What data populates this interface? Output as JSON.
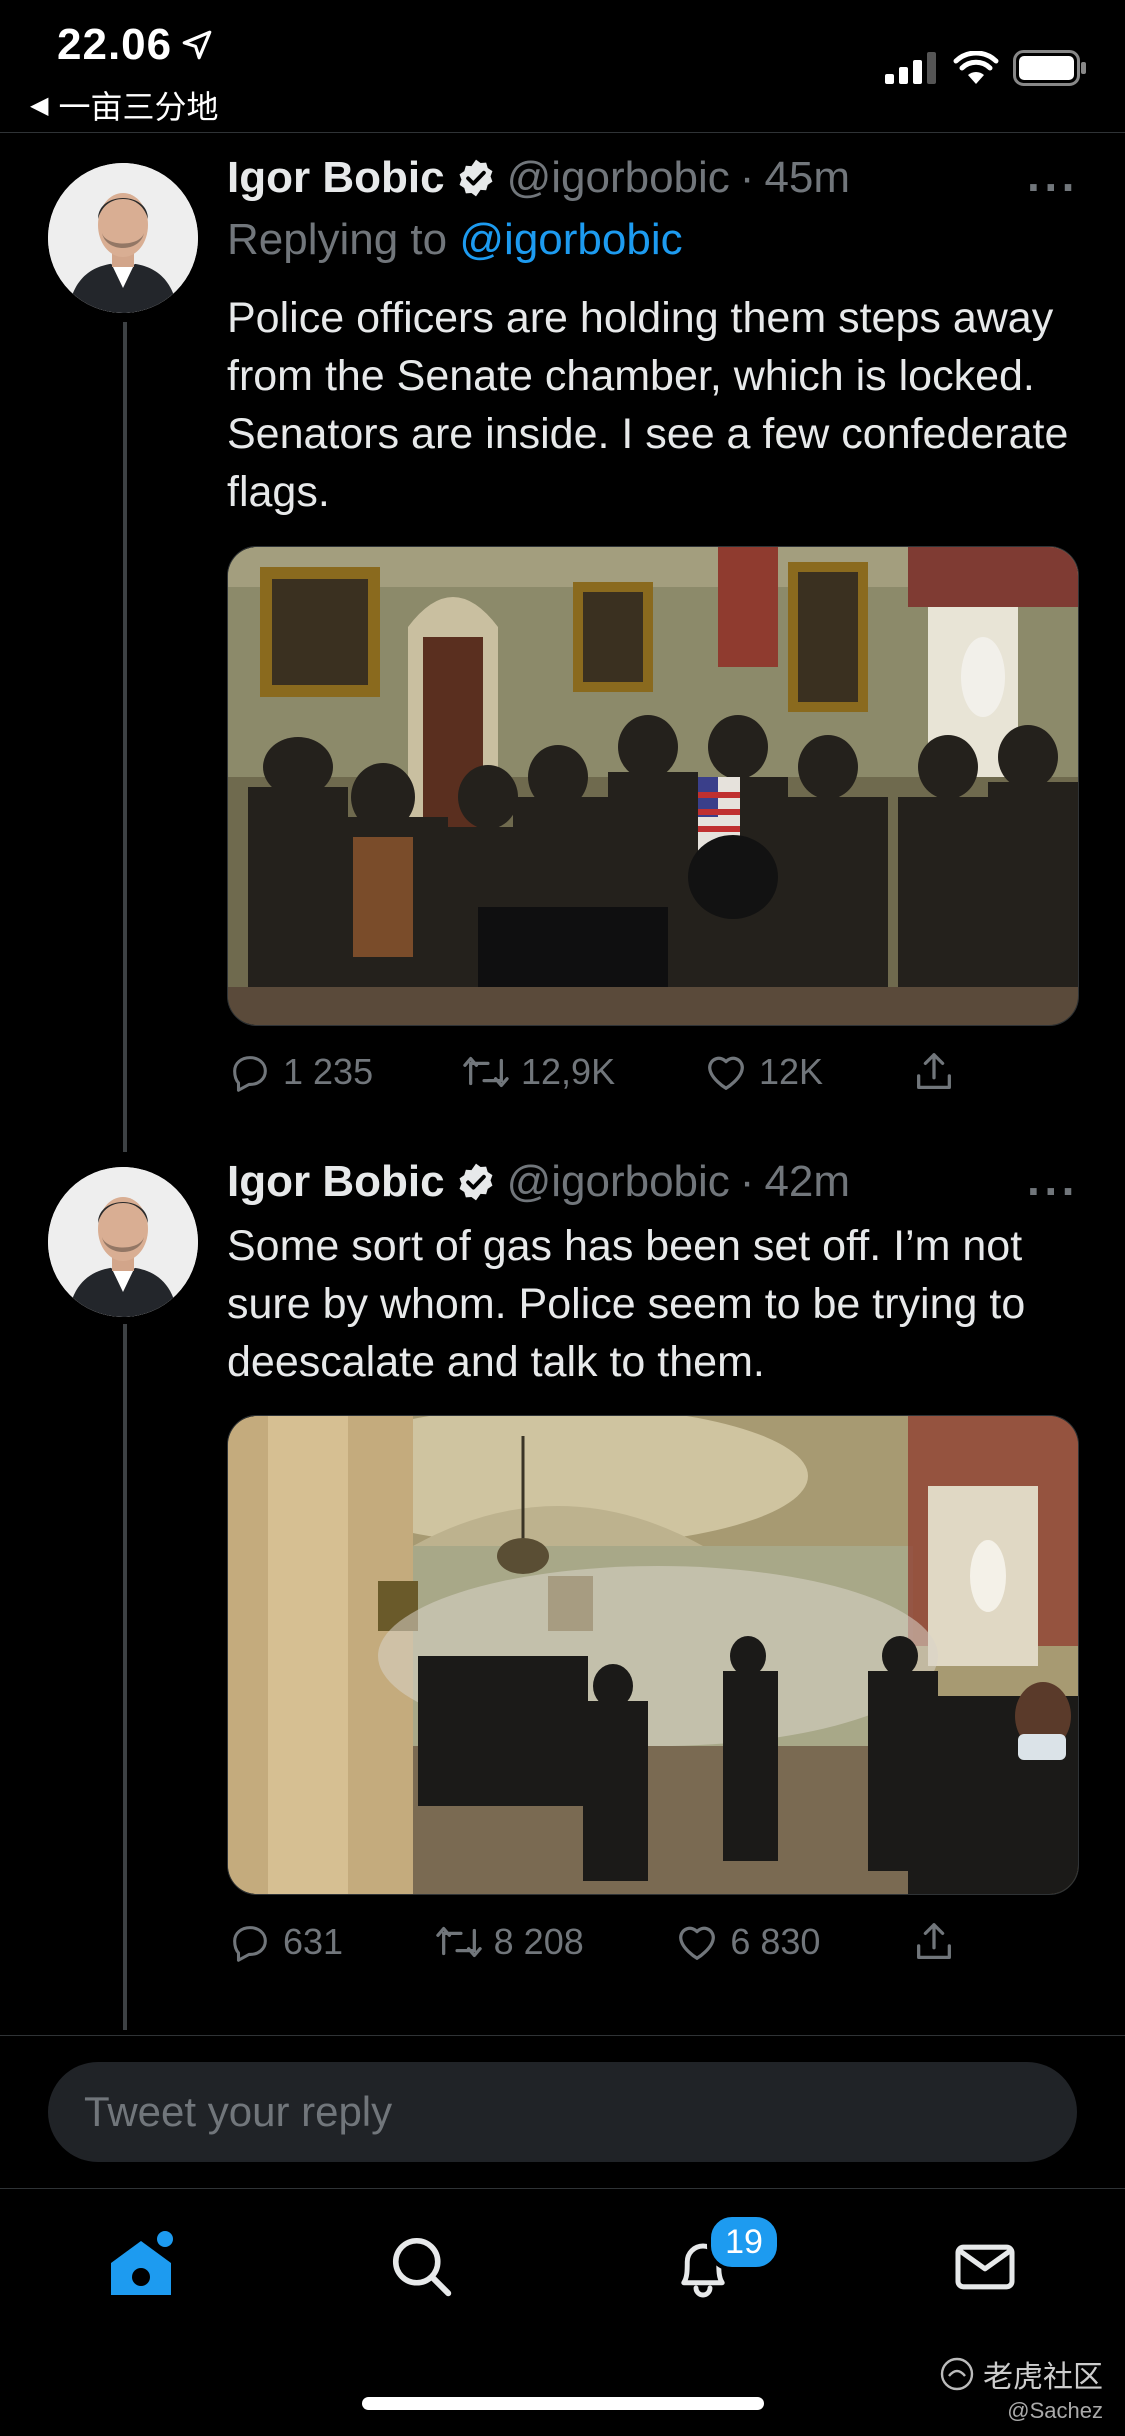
{
  "status_bar": {
    "time": "22.06",
    "back_label": "一亩三分地"
  },
  "tweets": [
    {
      "name": "Igor Bobic",
      "handle": "@igorbobic",
      "dot": "·",
      "time": "45m",
      "replying_prefix": "Replying to",
      "replying_to": "@igorbobic",
      "text": "Police officers are holding them steps away from the Senate chamber, which is locked. Senators are inside. I see a few confederate flags.",
      "replies": "1 235",
      "retweets": "12,9K",
      "likes": "12K"
    },
    {
      "name": "Igor Bobic",
      "handle": "@igorbobic",
      "dot": "·",
      "time": "42m",
      "text": "Some sort of gas has been set off. I’m not sure by whom. Police seem to be trying to deescalate and talk to them.",
      "replies": "631",
      "retweets": "8 208",
      "likes": "6 830"
    }
  ],
  "reply_placeholder": "Tweet your reply",
  "tabs": {
    "notifications_badge": "19"
  },
  "watermark": {
    "brand": "老虎社区",
    "user": "@Sachez"
  },
  "colors": {
    "accent": "#1d9bf0",
    "background": "#000000",
    "secondary_text": "#71767b"
  }
}
